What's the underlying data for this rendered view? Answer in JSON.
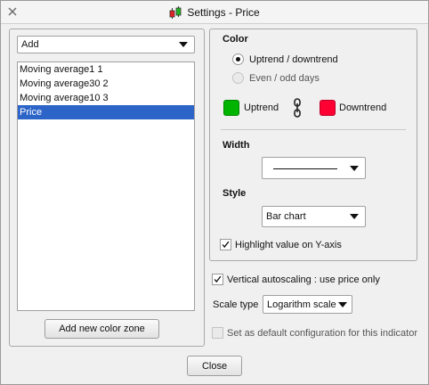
{
  "window": {
    "title": "Settings - Price",
    "close_icon": "close-icon",
    "app_icon": "candlestick-chart-icon"
  },
  "left": {
    "add_select": {
      "value": "Add"
    },
    "list_items": [
      {
        "label": "Moving average1 1",
        "selected": false
      },
      {
        "label": "Moving average30 2",
        "selected": false
      },
      {
        "label": "Moving average10 3",
        "selected": false
      },
      {
        "label": "Price",
        "selected": true
      }
    ],
    "add_color_zone_label": "Add new color zone"
  },
  "color_section": {
    "title": "Color",
    "radio_uptrend": "Uptrend / downtrend",
    "radio_evenodd": "Even / odd days",
    "selected": "uptrend",
    "uptrend_label": "Uptrend",
    "downtrend_label": "Downtrend",
    "uptrend_color": "#00b400",
    "downtrend_color": "#ff0033",
    "link_icon": "chain-link-icon"
  },
  "width_section": {
    "title": "Width",
    "style_icon": "solid-line-icon"
  },
  "style_section": {
    "title": "Style",
    "value": "Bar chart"
  },
  "highlight": {
    "label": "Highlight value on Y-axis",
    "checked": true
  },
  "vertical_autoscaling": {
    "label": "Vertical autoscaling : use price only",
    "checked": true
  },
  "scale_type": {
    "label": "Scale type",
    "value": "Logarithm scale"
  },
  "default_config": {
    "label": "Set as default configuration for this indicator",
    "checked": false
  },
  "close_button_label": "Close",
  "colors": {
    "selection": "#2c64c8"
  }
}
